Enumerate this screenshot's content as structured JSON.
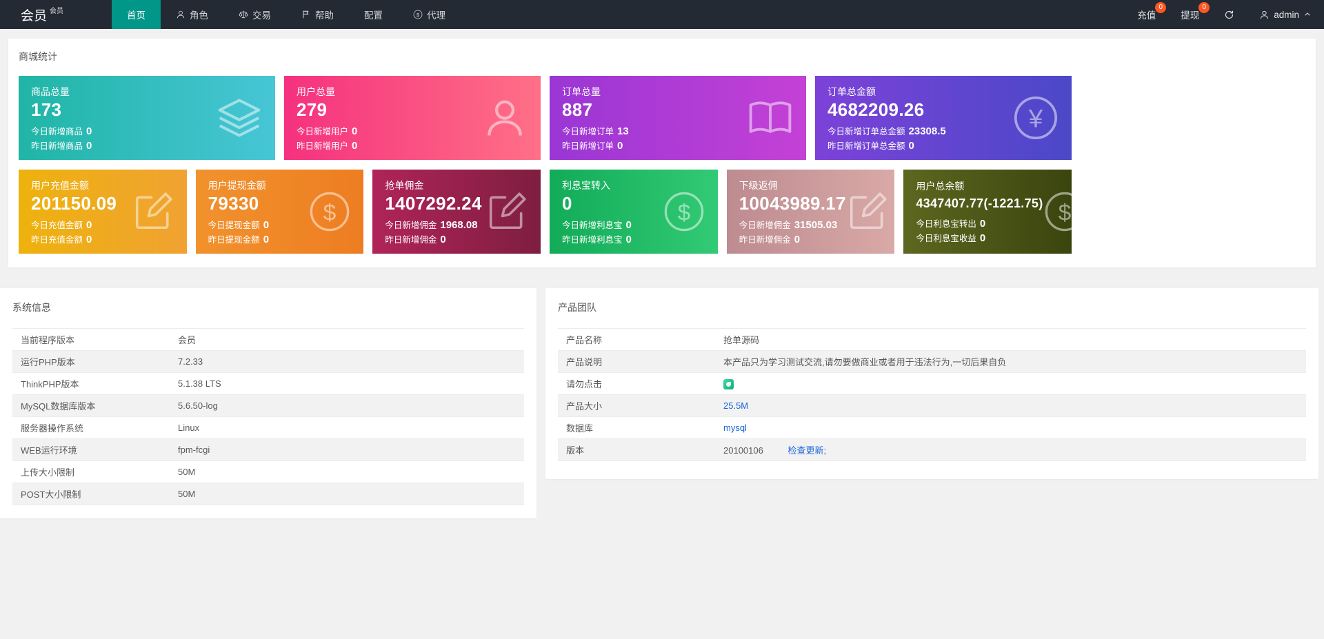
{
  "colors": {
    "navbar_bg": "#242a33",
    "nav_active": "#009688",
    "badge": "#ff5722",
    "link": "#1665d8"
  },
  "navbar": {
    "brand": "会员",
    "brand_sup": "会员",
    "items": [
      {
        "label": "首页"
      },
      {
        "label": "角色",
        "icon": "person-icon"
      },
      {
        "label": "交易",
        "icon": "scales-icon"
      },
      {
        "label": "帮助",
        "icon": "flag-icon"
      },
      {
        "label": "配置"
      },
      {
        "label": "代理",
        "icon": "dollar-circle-icon"
      }
    ],
    "recharge": {
      "label": "充值",
      "badge": "0"
    },
    "withdraw": {
      "label": "提现",
      "badge": "0"
    },
    "username": "admin"
  },
  "stats": {
    "title": "商城统计",
    "row1": [
      {
        "title": "商品总量",
        "value": "173",
        "line1_label": "今日新增商品",
        "line1_value": "0",
        "line2_label": "昨日新增商品",
        "line2_value": "0",
        "icon": "layers-icon",
        "colors": [
          "#20b5a6",
          "#47c6d6"
        ]
      },
      {
        "title": "用户总量",
        "value": "279",
        "line1_label": "今日新增用户",
        "line1_value": "0",
        "line2_label": "昨日新增用户",
        "line2_value": "0",
        "icon": "person-icon",
        "colors": [
          "#f5317f",
          "#ff7086"
        ]
      },
      {
        "title": "订单总量",
        "value": "887",
        "line1_label": "今日新增订单",
        "line1_value": "13",
        "line2_label": "昨日新增订单",
        "line2_value": "0",
        "icon": "book-icon",
        "colors": [
          "#9a36d4",
          "#c441d6"
        ]
      },
      {
        "title": "订单总金额",
        "value": "4682209.26",
        "line1_label": "今日新增订单总金额",
        "line1_value": "23308.5",
        "line2_label": "昨日新增订单总金额",
        "line2_value": "0",
        "icon": "yen-circle-icon",
        "colors": [
          "#7c42d8",
          "#4b48c8"
        ]
      }
    ],
    "row2": [
      {
        "title": "用户充值金额",
        "value": "201150.09",
        "line1_label": "今日充值金额",
        "line1_value": "0",
        "line2_label": "昨日充值金额",
        "line2_value": "0",
        "icon": "compose-icon",
        "colors": [
          "#eeb20d",
          "#f0a232"
        ]
      },
      {
        "title": "用户提现金额",
        "value": "79330",
        "line1_label": "今日提现金额",
        "line1_value": "0",
        "line2_label": "昨日提现金额",
        "line2_value": "0",
        "icon": "dollar-circle-icon",
        "colors": [
          "#f1922d",
          "#ee7d22"
        ]
      },
      {
        "title": "抢单佣金",
        "value": "1407292.24",
        "line1_label": "今日新增佣金",
        "line1_value": "1968.08",
        "line2_label": "昨日新增佣金",
        "line2_value": "0",
        "icon": "compose-icon",
        "colors": [
          "#b02458",
          "#7e1e40"
        ]
      },
      {
        "title": "利息宝转入",
        "value": "0",
        "line1_label": "今日新增利息宝",
        "line1_value": "0",
        "line2_label": "昨日新增利息宝",
        "line2_value": "0",
        "icon": "dollar-circle-icon",
        "colors": [
          "#12ab58",
          "#32ca74"
        ]
      },
      {
        "title": "下级返佣",
        "value": "10043989.17",
        "line1_label": "今日新增佣金",
        "line1_value": "31505.03",
        "line2_label": "昨日新增佣金",
        "line2_value": "0",
        "icon": "compose-icon",
        "colors": [
          "#bd8b90",
          "#d9a9a7"
        ]
      },
      {
        "title": "用户总余额",
        "value": "4347407.77(-1221.75)",
        "line1_label": "今日利息宝转出",
        "line1_value": "0",
        "line2_label": "今日利息宝收益",
        "line2_value": "0",
        "icon": "dollar-circle-icon",
        "colors": [
          "#5d671f",
          "#3a440e"
        ]
      }
    ]
  },
  "system_info": {
    "title": "系统信息",
    "rows": [
      {
        "label": "当前程序版本",
        "value": "会员"
      },
      {
        "label": "运行PHP版本",
        "value": "7.2.33"
      },
      {
        "label": "ThinkPHP版本",
        "value": "5.1.38 LTS"
      },
      {
        "label": "MySQL数据库版本",
        "value": "5.6.50-log"
      },
      {
        "label": "服务器操作系统",
        "value": "Linux"
      },
      {
        "label": "WEB运行环境",
        "value": "fpm-fcgi"
      },
      {
        "label": "上传大小限制",
        "value": "50M"
      },
      {
        "label": "POST大小限制",
        "value": "50M"
      }
    ]
  },
  "product_team": {
    "title": "产品团队",
    "rows": [
      {
        "label": "产品名称",
        "value": "抢单源码"
      },
      {
        "label": "产品说明",
        "value": "本产品只为学习测试交流,请勿要做商业或者用于违法行为,一切后果自负"
      },
      {
        "label": "请勿点击",
        "value": ""
      },
      {
        "label": "产品大小",
        "value": "25.5M"
      },
      {
        "label": "数据库",
        "value": "mysql"
      },
      {
        "label": "版本",
        "value": "20100106",
        "link": "检查更新;"
      }
    ]
  }
}
